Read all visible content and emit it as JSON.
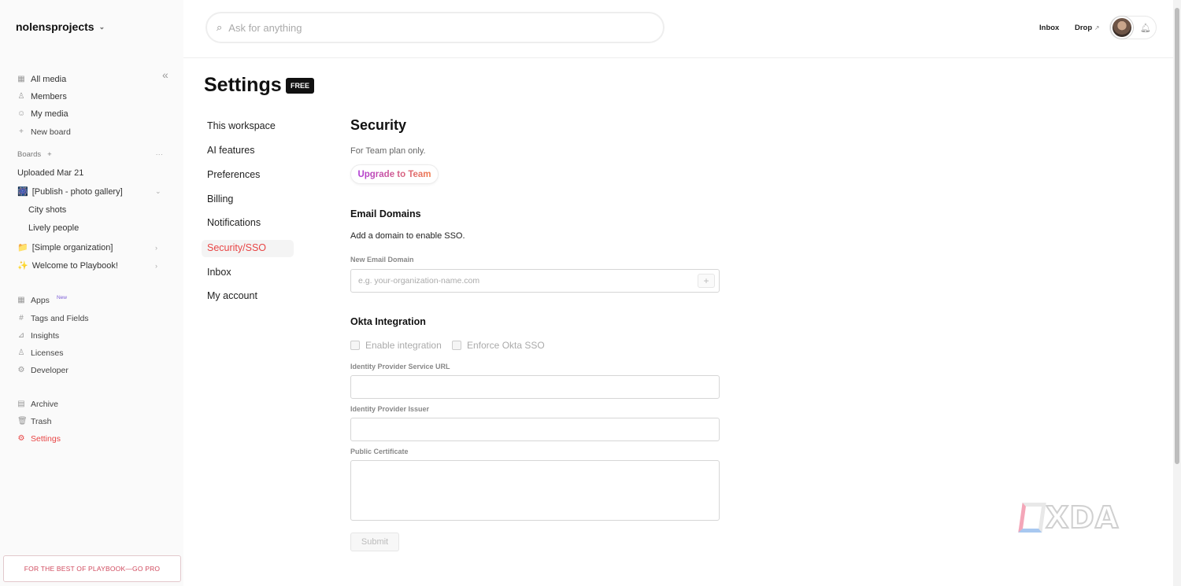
{
  "workspace": {
    "name": "nolensprojects"
  },
  "sidebar": {
    "main_items": [
      {
        "label": "All media",
        "icon": "grid-icon"
      },
      {
        "label": "Members",
        "icon": "person-icon"
      },
      {
        "label": "My media",
        "icon": "smiley-icon"
      },
      {
        "label": "New board",
        "icon": "plus-icon"
      }
    ],
    "boards_header": "Boards",
    "boards_more": "···",
    "tree": {
      "uploaded": "Uploaded Mar 21",
      "publish": "[Publish - photo gallery]",
      "city": "City shots",
      "lively": "Lively people",
      "simple": "[Simple organization]",
      "welcome": "Welcome to Playbook!"
    },
    "tools": [
      {
        "label": "Apps",
        "badge": "New",
        "icon": "apps-icon"
      },
      {
        "label": "Tags and Fields",
        "icon": "hash-icon"
      },
      {
        "label": "Insights",
        "icon": "chart-icon"
      },
      {
        "label": "Licenses",
        "icon": "license-icon"
      },
      {
        "label": "Developer",
        "icon": "developer-icon"
      }
    ],
    "bottom": [
      {
        "label": "Archive",
        "icon": "archive-icon"
      },
      {
        "label": "Trash",
        "icon": "trash-icon"
      },
      {
        "label": "Settings",
        "icon": "gear-icon",
        "active": true
      }
    ],
    "go_pro": "FOR THE BEST OF PLAYBOOK—GO PRO"
  },
  "topbar": {
    "search_placeholder": "Ask for anything",
    "inbox": "Inbox",
    "drop": "Drop"
  },
  "settings": {
    "title": "Settings",
    "plan_badge": "FREE",
    "nav": [
      "This workspace",
      "AI features",
      "Preferences",
      "Billing",
      "Notifications",
      "Security/SSO",
      "Inbox",
      "My account"
    ],
    "active_nav": "Security/SSO"
  },
  "security": {
    "title": "Security",
    "plan_note": "For Team plan only.",
    "upgrade_label": "Upgrade to Team",
    "email_domains": {
      "title": "Email Domains",
      "description": "Add a domain to enable SSO.",
      "field_label": "New Email Domain",
      "placeholder": "e.g. your-organization-name.com",
      "add_glyph": "+"
    },
    "okta": {
      "title": "Okta Integration",
      "enable_label": "Enable integration",
      "enforce_label": "Enforce Okta SSO",
      "idp_url_label": "Identity Provider Service URL",
      "idp_issuer_label": "Identity Provider Issuer",
      "cert_label": "Public Certificate"
    },
    "submit_label": "Submit"
  },
  "watermark": {
    "text": "XDA"
  },
  "colors": {
    "accent_red": "#e84545",
    "badge_bg": "#111111"
  }
}
